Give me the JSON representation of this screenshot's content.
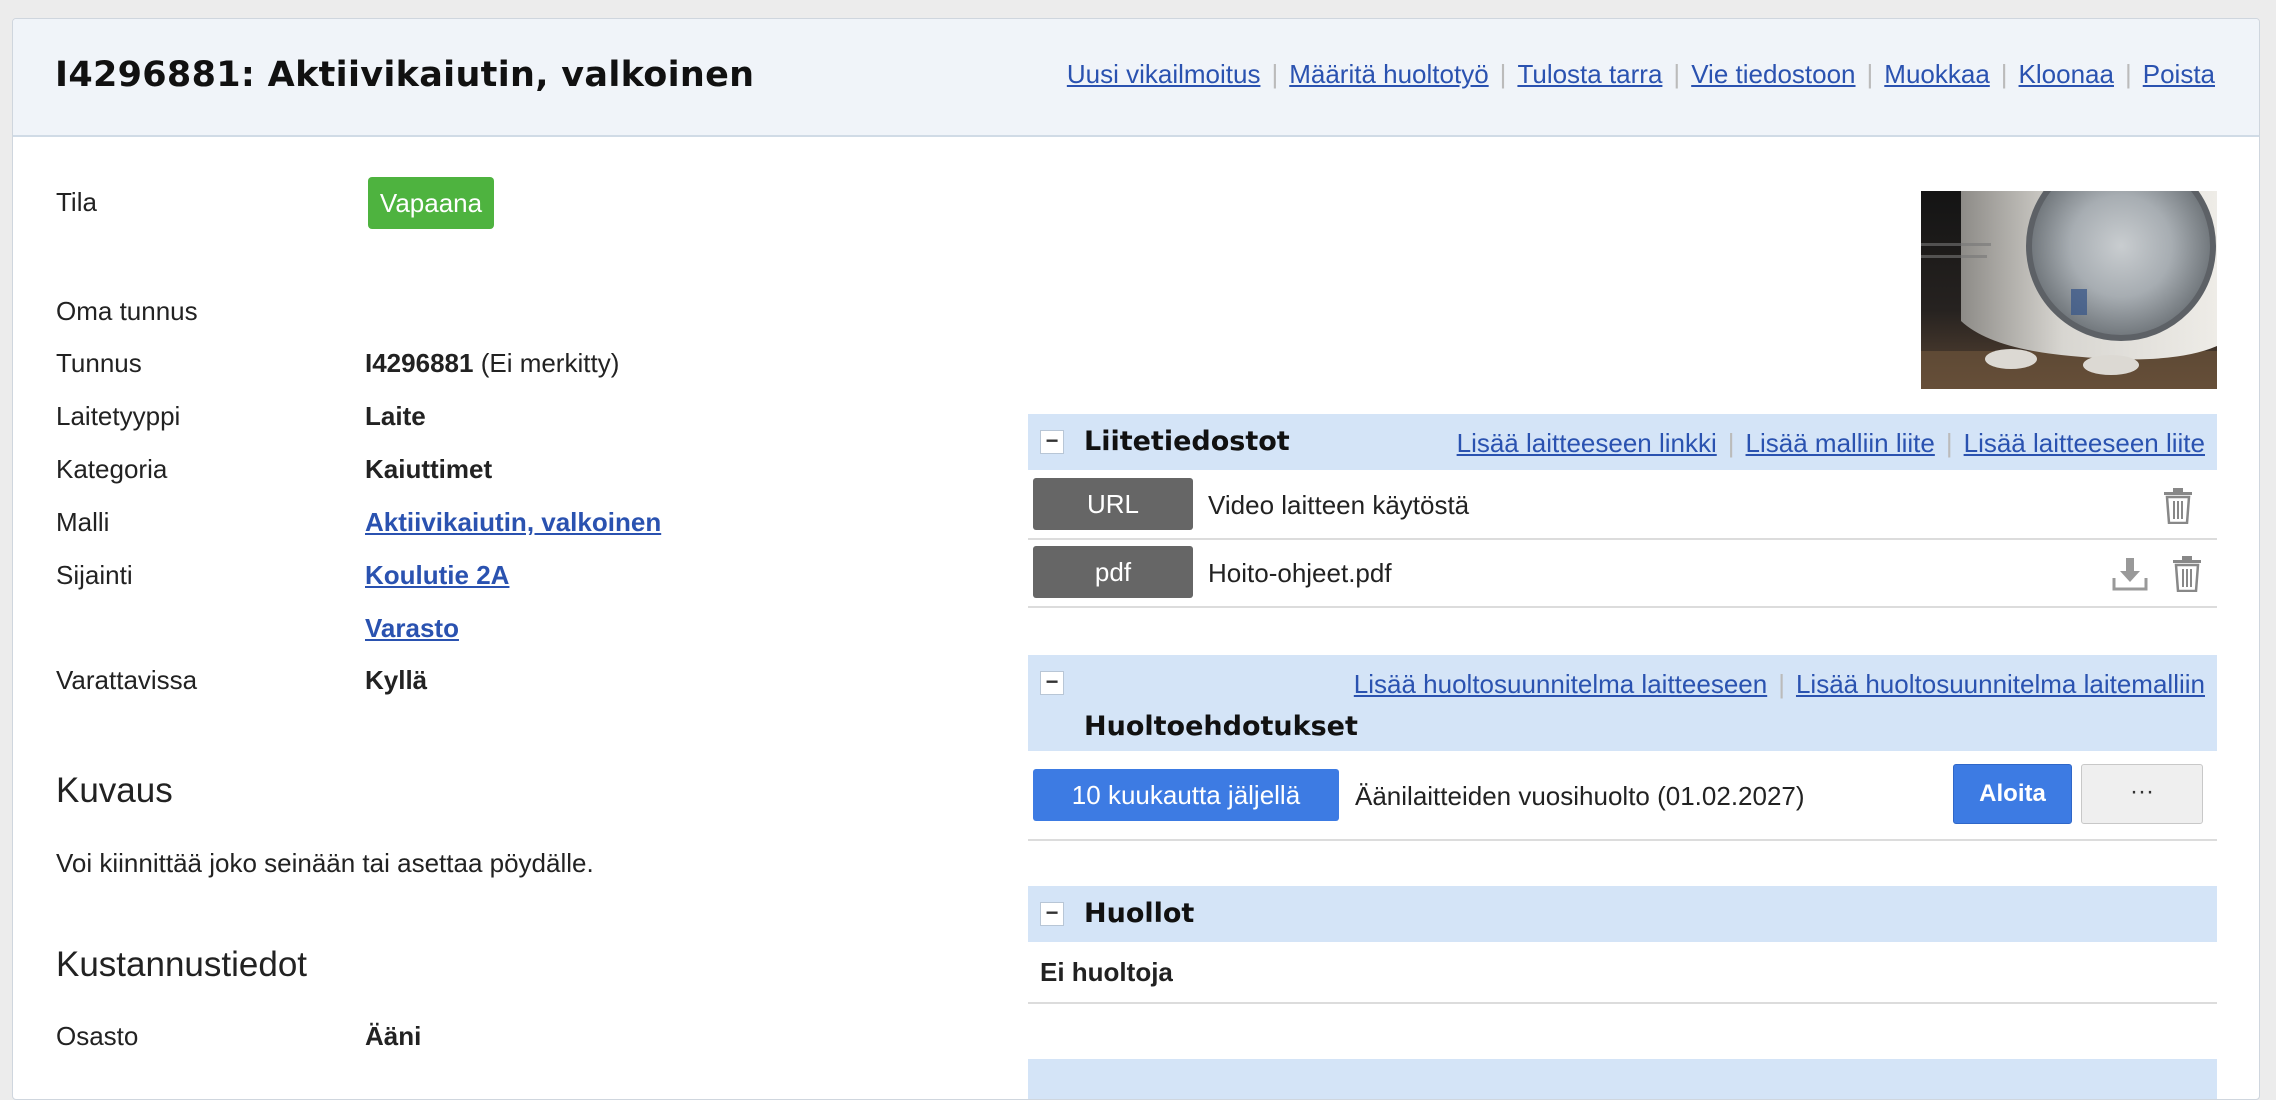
{
  "header": {
    "title": "I4296881: Aktiivikaiutin, valkoinen",
    "links": [
      "Uusi vikailmoitus",
      "Määritä huoltotyö",
      "Tulosta tarra",
      "Vie tiedostoon",
      "Muokkaa",
      "Kloonaa",
      "Poista"
    ]
  },
  "status": {
    "label": "Tila",
    "value": "Vapaana",
    "color": "#4eb33f"
  },
  "fields": {
    "oma_tunnus": {
      "label": "Oma tunnus"
    },
    "tunnus": {
      "label": "Tunnus",
      "value": "I4296881",
      "note": "(Ei merkitty)"
    },
    "laitetyyppi": {
      "label": "Laitetyyppi",
      "value": "Laite"
    },
    "kategoria": {
      "label": "Kategoria",
      "value": "Kaiuttimet"
    },
    "malli": {
      "label": "Malli",
      "value": "Aktiivikaiutin, valkoinen"
    },
    "sijainti": {
      "label": "Sijainti",
      "value": "Koulutie 2A",
      "value2": "Varasto"
    },
    "varattavissa": {
      "label": "Varattavissa",
      "value": "Kyllä"
    }
  },
  "kuvaus": {
    "title": "Kuvaus",
    "text": "Voi kiinnittää joko seinään tai asettaa pöydälle."
  },
  "kustannus": {
    "title": "Kustannustiedot",
    "osasto_label": "Osasto",
    "osasto_value": "Ääni"
  },
  "attachments": {
    "title": "Liitetiedostot",
    "links": [
      "Lisää laitteeseen linkki",
      "Lisää malliin liite",
      "Lisää laitteeseen liite"
    ],
    "items": [
      {
        "type": "URL",
        "name": "Video laitteen käytöstä"
      },
      {
        "type": "pdf",
        "name": "Hoito-ohjeet.pdf"
      }
    ]
  },
  "maintenance_plans": {
    "title": "Huoltoehdotukset",
    "links": [
      "Lisää huoltosuunnitelma laitteeseen",
      "Lisää huoltosuunnitelma laitemalliin"
    ],
    "item": {
      "remaining": "10 kuukautta jäljellä",
      "name": "Äänilaitteiden vuosihuolto (01.02.2027)",
      "start_label": "Aloita",
      "more_label": "···"
    }
  },
  "maintenances": {
    "title": "Huollot",
    "empty_text": "Ei huoltoja"
  },
  "colors": {
    "accent": "#3d7be3",
    "link": "#2a52b0",
    "bar": "#d4e4f7",
    "pill_grey": "#666666"
  },
  "collapse_symbol": "−"
}
